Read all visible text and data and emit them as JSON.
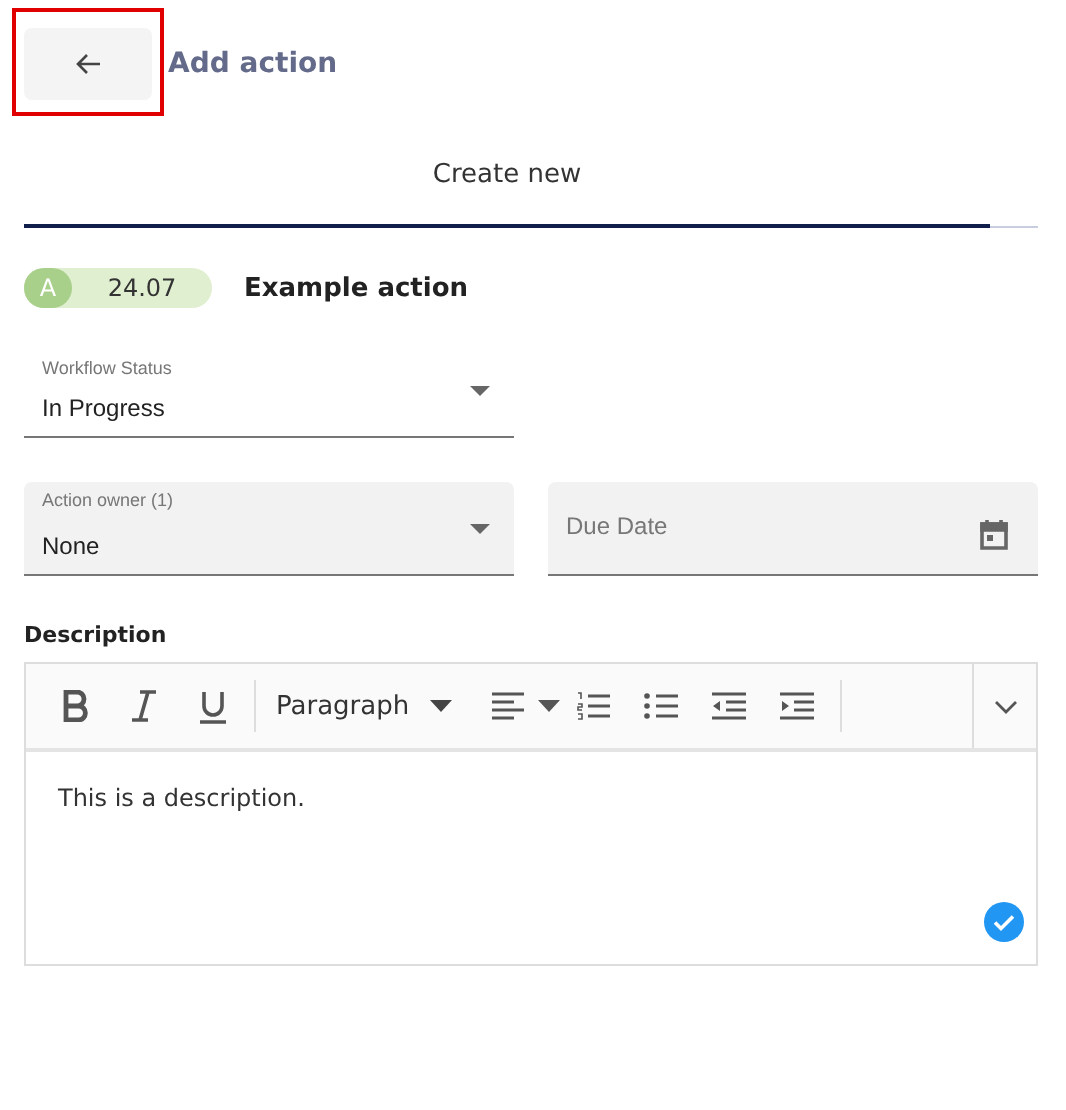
{
  "header": {
    "back_button": {
      "highlighted": true
    },
    "title": "Add action"
  },
  "tabs": [
    {
      "label": "Create new",
      "selected": true
    }
  ],
  "action": {
    "badge_letter": "A",
    "badge_number": "24.07",
    "name": "Example action"
  },
  "fields": [
    {
      "kind": "select",
      "label": "Workflow Status",
      "value": "In Progress",
      "filled": false
    },
    {
      "kind": "select",
      "label": "Action owner (1)",
      "value": "None",
      "filled": true
    },
    {
      "kind": "date",
      "placeholder": "Due Date",
      "filled": true
    }
  ],
  "description": {
    "label": "Description",
    "text": "This is a description.",
    "saved": true,
    "toolbar": [
      {
        "kind": "bold"
      },
      {
        "kind": "italic"
      },
      {
        "kind": "underline"
      },
      {
        "kind": "separator"
      },
      {
        "kind": "dropdown",
        "label": "Paragraph"
      },
      {
        "kind": "align"
      },
      {
        "kind": "ordered-list"
      },
      {
        "kind": "bullet-list"
      },
      {
        "kind": "outdent"
      },
      {
        "kind": "indent"
      },
      {
        "kind": "separator"
      }
    ]
  }
}
